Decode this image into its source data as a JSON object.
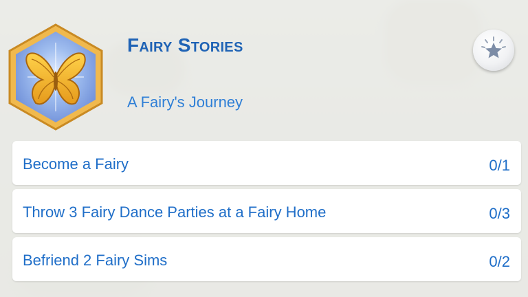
{
  "header": {
    "title": "Fairy Stories",
    "subtitle": "A Fairy's Journey",
    "badge_icon": "butterfly-wings-icon",
    "action_icon": "star-icon"
  },
  "goals": [
    {
      "label": "Become a Fairy",
      "progress": "0/1"
    },
    {
      "label": "Throw 3 Fairy Dance Parties at a Fairy Home",
      "progress": "0/3"
    },
    {
      "label": "Befriend 2 Fairy Sims",
      "progress": "0/2"
    }
  ],
  "colors": {
    "title": "#1f63b5",
    "text": "#1f6ec8",
    "badge_frame": "#e3a53a",
    "badge_fill": "#8fb3ea"
  }
}
